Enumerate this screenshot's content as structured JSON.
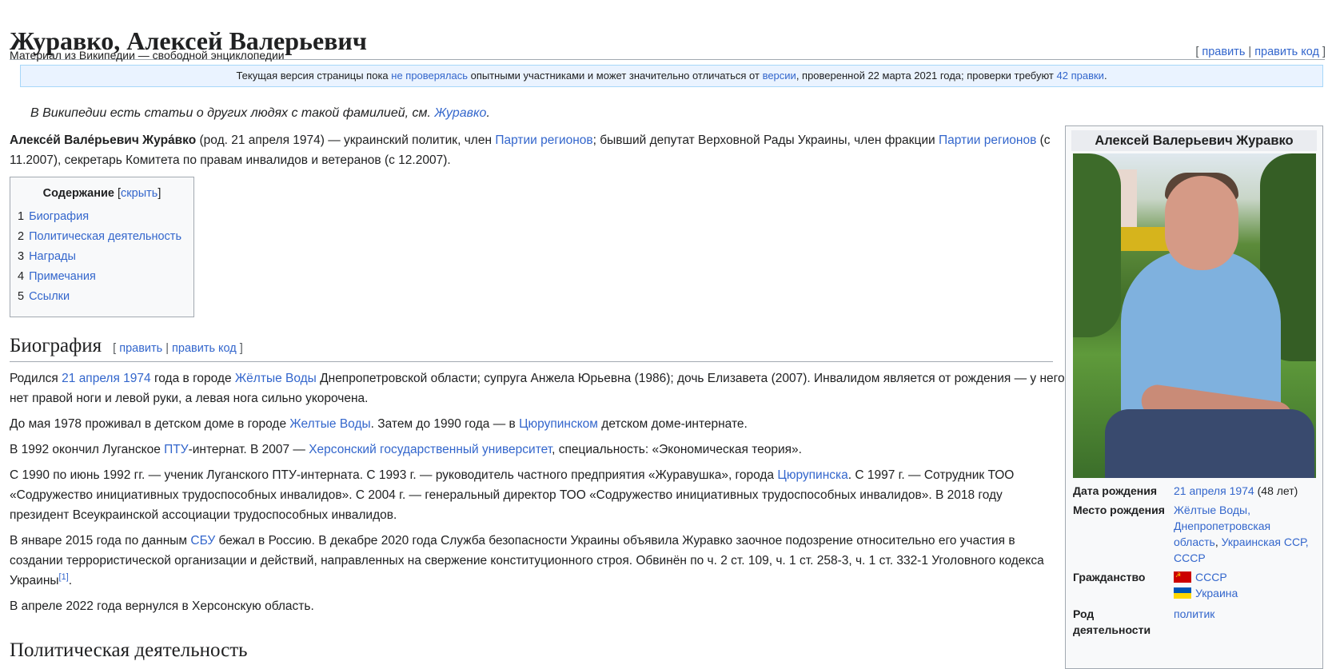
{
  "page": {
    "title": "Журавко, Алексей Валерьевич",
    "tagline": "Материал из Википедии — свободной энциклопедии",
    "edit": "править",
    "edit_source": "править код"
  },
  "flagged": {
    "t1": "Текущая версия страницы пока ",
    "link1": "не проверялась",
    "t2": " опытными участниками и может значительно отличаться от ",
    "link2": "версии",
    "t3": ", проверенной 22 марта 2021 года; проверки требуют ",
    "link3": "42 правки",
    "t4": "."
  },
  "hatnote": {
    "text": "В Википедии есть статьи о других людях с такой фамилией, см. ",
    "link": "Журавко",
    "end": "."
  },
  "lead": {
    "name": "Алексе́й Вале́рьевич Жура́вко",
    "t1": " (род. 21 апреля 1974) — украинский политик, член ",
    "link1": "Партии регионов",
    "t2": "; бывший депутат Верховной Рады Украины, член фракции ",
    "link2": "Партии регионов",
    "t3": " (с 11.2007), секретарь Комитета по правам инвалидов и ветеранов (с 12.2007)."
  },
  "toc": {
    "heading": "Содержание",
    "hide": "скрыть",
    "items": [
      {
        "num": "1",
        "label": "Биография"
      },
      {
        "num": "2",
        "label": "Политическая деятельность"
      },
      {
        "num": "3",
        "label": "Награды"
      },
      {
        "num": "4",
        "label": "Примечания"
      },
      {
        "num": "5",
        "label": "Ссылки"
      }
    ]
  },
  "section1": {
    "heading": "Биография",
    "edit": "править",
    "edit_source": "править код"
  },
  "paras": {
    "p1": {
      "t1": "Родился ",
      "link1": "21 апреля 1974",
      "t2": " года в городе ",
      "link2": "Жёлтые Воды",
      "t3": " Днепропетровской области; супруга Анжела Юрьевна (1986); дочь Елизавета (2007). Инвалидом является от рождения — у него нет правой ноги и левой руки, а левая нога сильно укорочена."
    },
    "p2": {
      "t1": "До мая 1978 проживал в детском доме в городе ",
      "link1": "Желтые Воды",
      "t2": ". Затем до 1990 года — в ",
      "link2": "Цюрупинском",
      "t3": " детском доме-интернате."
    },
    "p3": {
      "t1": "В 1992 окончил Луганское ",
      "link1": "ПТУ",
      "t2": "-интернат. В 2007 — ",
      "link2": "Херсонский государственный университет",
      "t3": ", специальность: «Экономическая теория»."
    },
    "p4": {
      "t1": "С 1990 по июнь 1992 гг. — ученик Луганского ПТУ-интерната. С 1993 г. — руководитель частного предприятия «Журавушка», города ",
      "link1": "Цюрупинска",
      "t2": ". С 1997 г. — Сотрудник ТОО «Содружество инициативных трудоспособных инвалидов». С 2004 г. — генеральный директор ТОО «Содружество инициативных трудоспособных инвалидов». В 2018 году президент Всеукраинской ассоциации трудоспособных инвалидов."
    },
    "p5": {
      "t1": "В январе 2015 года по данным ",
      "link1": "СБУ",
      "t2": " бежал в Россию. В декабре 2020 года Служба безопасности Украины объявила Журавко заочное подозрение относительно его участия в создании террористической организации и действий, направленных на свержение конституционного строя. Обвинён по ч. 2 ст. 109, ч. 1 ст. 258-3, ч. 1 ст. 332-1 Уголовного кодекса Украины",
      "ref": "[1]",
      "t3": "."
    },
    "p6": {
      "t1": "В апреле 2022 года вернулся в Херсонскую область."
    }
  },
  "section2": {
    "heading": "Политическая деятельность"
  },
  "infobox": {
    "title": "Алексей Валерьевич Журавко",
    "birth_date_label": "Дата рождения",
    "birth_date": "21 апреля 1974",
    "age": " (48 лет)",
    "birth_place_label": "Место рождения",
    "birth_place_1": "Жёлтые Воды,",
    "birth_place_2": "Днепропетровская область",
    "birth_place_sep": ", ",
    "birth_place_3": "Украинская ССР",
    "birth_place_sep2": ",",
    "birth_place_4": "СССР",
    "citizenship_label": "Гражданство",
    "citizenship": [
      "СССР",
      "Украина"
    ],
    "occupation_label": "Род деятельности",
    "occupation": "политик"
  },
  "colors": {
    "link": "#3366cc",
    "text": "#202122",
    "flagged_bg": "#eaf3ff",
    "infobox_bg": "#f8f9fa"
  }
}
